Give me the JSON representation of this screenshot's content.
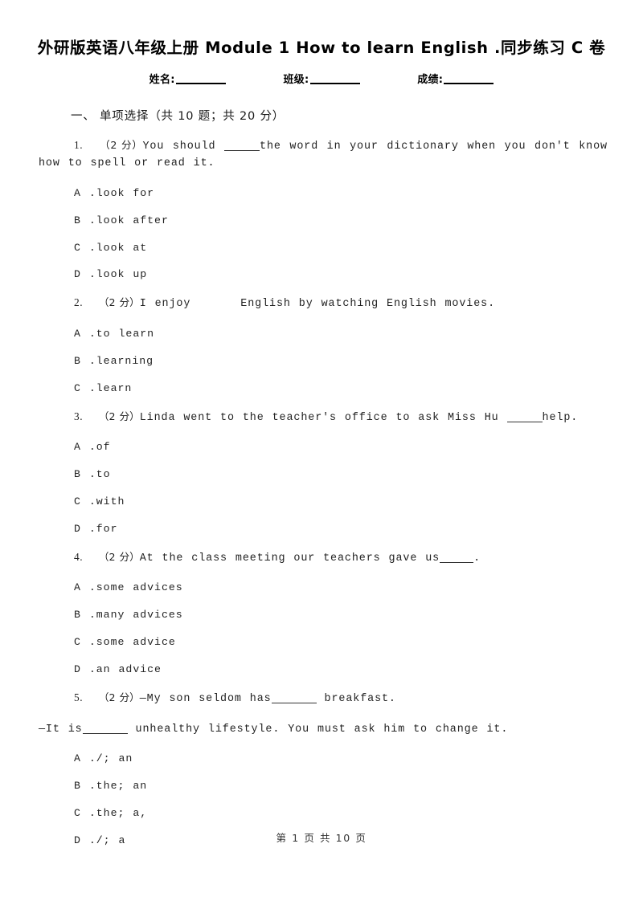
{
  "document": {
    "title": "外研版英语八年级上册 Module 1 How to learn English .同步练习 C 卷",
    "meta": {
      "name_label": "姓名:",
      "class_label": "班级:",
      "score_label": "成绩:"
    },
    "footer": "第 1 页 共 10 页"
  },
  "section": {
    "heading": "一、 单项选择（共 10 题；共 20 分）"
  },
  "questions": [
    {
      "number": "1.",
      "points": "（2 分）",
      "stem_before": "You should ",
      "blank": "blank-underline",
      "stem_after": "the word in your dictionary when you don't know how to spell or read it.",
      "options": [
        {
          "letter": "A .",
          "text": "look for"
        },
        {
          "letter": "B .",
          "text": "look after"
        },
        {
          "letter": "C .",
          "text": "look at"
        },
        {
          "letter": "D .",
          "text": "look up"
        }
      ]
    },
    {
      "number": "2.",
      "points": "（2 分）",
      "stem_before": "I enjoy",
      "blank": "blank-space",
      "stem_after": "English by watching English movies.",
      "options": [
        {
          "letter": "A .",
          "text": "to learn"
        },
        {
          "letter": "B .",
          "text": "learning"
        },
        {
          "letter": "C .",
          "text": "learn"
        }
      ]
    },
    {
      "number": "3.",
      "points": "（2 分）",
      "stem_before": "Linda went to the teacher's office to ask Miss Hu ",
      "blank": "blank-underline",
      "stem_after": "help.",
      "options": [
        {
          "letter": "A .",
          "text": "of"
        },
        {
          "letter": "B .",
          "text": "to"
        },
        {
          "letter": "C .",
          "text": "with"
        },
        {
          "letter": "D .",
          "text": "for"
        }
      ]
    },
    {
      "number": "4.",
      "points": "（2 分）",
      "stem_before": "At the class meeting our teachers gave us",
      "blank": "blank-underline",
      "stem_after": ".",
      "options": [
        {
          "letter": "A .",
          "text": "some advices"
        },
        {
          "letter": "B .",
          "text": "many advices"
        },
        {
          "letter": "C .",
          "text": "some advice"
        },
        {
          "letter": "D .",
          "text": "an advice"
        }
      ]
    },
    {
      "number": "5.",
      "points": "（2 分）",
      "stem_before": "—My son seldom has",
      "blank": "blank-underline",
      "stem_after": " breakfast.",
      "line2_before": "—It is",
      "line2_blank": "blank-underline",
      "line2_after": " unhealthy lifestyle. You must ask him to change it.",
      "options": [
        {
          "letter": "A .",
          "text": "/; an"
        },
        {
          "letter": "B .",
          "text": "the; an"
        },
        {
          "letter": "C .",
          "text": "the; a,"
        },
        {
          "letter": "D .",
          "text": "/; a"
        }
      ]
    }
  ]
}
